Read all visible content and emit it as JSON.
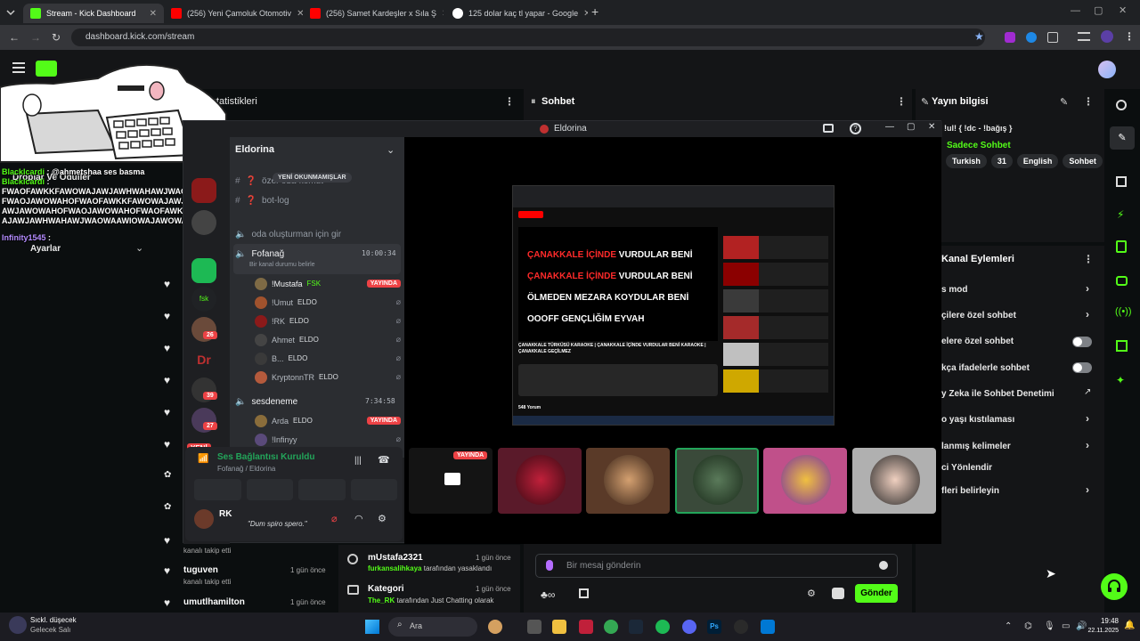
{
  "browser": {
    "tabs": [
      {
        "title": "Stream - Kick Dashboard",
        "color": "#53fc18"
      },
      {
        "title": "(256) Yeni Çamoluk Otomotiv",
        "color": "#ff0000"
      },
      {
        "title": "(256) Samet Kardeşler x Sıla Ş",
        "color": "#ff0000"
      },
      {
        "title": "125 dolar kaç tl yapar - Google",
        "color": "#4285f4"
      }
    ],
    "url": "dashboard.kick.com/stream"
  },
  "kick": {
    "stats_title": "Yayın İstatistikleri",
    "chat_title": "Sohbet",
    "info_title": "Yayın bilgisi",
    "info_line": "!ul! { !dc - !bağış }",
    "sadece": "Sadece Sohbet",
    "tags": [
      "Turkish",
      "31",
      "English",
      "Sohbet"
    ],
    "actions_title": "Kanal Eylemleri",
    "actions": [
      {
        "label": "s mod",
        "ctrl": "chevron"
      },
      {
        "label": "çilere özel sohbet",
        "ctrl": "chevron"
      },
      {
        "label": "elere özel sohbet",
        "ctrl": "toggle"
      },
      {
        "label": "kça ifadelerle sohbet",
        "ctrl": "toggle"
      },
      {
        "label": "y Zeka ile Sohbet Denetimi",
        "ctrl": "external"
      },
      {
        "label": "o yaşı kıstılaması",
        "ctrl": "chevron"
      },
      {
        "label": "lanmış kelimeler",
        "ctrl": "chevron"
      },
      {
        "label": "ci Yönlendir",
        "ctrl": "none"
      },
      {
        "label": "fleri belirleyin",
        "ctrl": "chevron"
      }
    ],
    "drops": "Droplar Ve Ödüller",
    "settings": "Ayarlar",
    "yeni": "YENİ",
    "followers": [
      {
        "name": "tuguven",
        "sub": "kanalı takip etti",
        "time": "1 gün önce"
      },
      {
        "name": "umutlhamilton",
        "sub": "",
        "time": "1 gün önce"
      }
    ],
    "first_follow_sub": "kanalı takip etti",
    "events": [
      {
        "name": "mUstafa2321",
        "by": "furkansalihkaya",
        "rest": "tarafından yasaklandı",
        "time": "1 gün önce"
      },
      {
        "name": "Kategori",
        "by": "The_RK",
        "rest": "tarafından Just Chatting olarak",
        "time": "1 gün önce"
      }
    ],
    "message_placeholder": "Bir mesaj gönderin",
    "send": "Gönder"
  },
  "overlay_chat": [
    {
      "user": "Blacklcardi",
      "text": ": @ahmetshaa ses basma"
    },
    {
      "user": "Blacklcardi",
      "text": ":"
    },
    {
      "user": "",
      "text": "FWAOFAWKKFAWOWAJAWJAWHWAHAWJWAOWAWI"
    },
    {
      "user": "",
      "text": "FWAOJAWOWAHOFWAOFAWKKFAWOWAJAWJAWHWAH"
    },
    {
      "user": "",
      "text": "AWJAWOWAHOFWAOJAWOWAHOFWAOFAWKKFAWOW"
    },
    {
      "user": "",
      "text": "AJAWJAWHWAHAWJWAOWAAWIOWAJAWOWAHO"
    },
    {
      "user": "Infinity1545",
      "text": ":"
    }
  ],
  "discord": {
    "window_title": "Eldorina",
    "server": "Eldorina",
    "new_unread": "YENİ OKUNMAMIŞLAR",
    "channels": [
      {
        "name": "özel-oda-komut"
      },
      {
        "name": "bot-log"
      }
    ],
    "create_room": "oda oluşturman için gir",
    "voice1": {
      "name": "Fofanağ",
      "time": "10:00:34",
      "status": "Bir kanal durumu belirle"
    },
    "users1": [
      {
        "name": "!Mustafa",
        "tag": "FSK",
        "live": true,
        "color": "#7e6a45"
      },
      {
        "name": "!Umut",
        "tag": "ELDO",
        "live": false,
        "color": "#a0522d"
      },
      {
        "name": "!RK",
        "tag": "ELDO",
        "live": false,
        "color": "#8b1a1a"
      },
      {
        "name": "Ahmet",
        "tag": "ELDO",
        "live": false,
        "color": "#444444"
      },
      {
        "name": "B...",
        "tag": "ELDO",
        "live": false,
        "color": "#3a3a3a"
      },
      {
        "name": "KryptonnTR",
        "tag": "ELDO",
        "live": false,
        "color": "#b45a3c"
      }
    ],
    "voice2": {
      "name": "sesdeneme",
      "time": "7:34:58"
    },
    "users2": [
      {
        "name": "Arda",
        "tag": "ELDO",
        "live": true,
        "color": "#8a6d3b"
      },
      {
        "name": "!Infinyy",
        "tag": "",
        "live": false,
        "color": "#5a4a7a"
      }
    ],
    "live_label": "YAYINDA",
    "conn_title": "Ses Bağlantısı Kuruldu",
    "conn_sub": "Fofanağ / Eldorina",
    "me_name": "RK",
    "me_status": "\"Dum spiro spero.\"",
    "server_badges": [
      "26",
      "39",
      "27"
    ]
  },
  "youtube": {
    "lyrics": [
      {
        "a": "ÇANAKKALE İÇİNDE",
        "b": " VURDULAR BENİ"
      },
      {
        "a": "ÇANAKKALE İÇİNDE",
        "b": " VURDULAR BENİ"
      },
      {
        "a": "",
        "b": "ÖLMEDEN MEZARA KOYDULAR BENİ"
      },
      {
        "a": "",
        "b": "OOOFF GENÇLİĞİM EYVAH"
      }
    ],
    "video_title": "ÇANAKKALE TÜRKÜSÜ KARAOKE | ÇANAKKALE İÇİNDE VURDULAR BENİ KARAOKE | ÇANAKKALE GEÇİLMEZ",
    "comments": "548 Yorum"
  },
  "taskbar": {
    "weather_temp": "Sıckl. düşecek",
    "weather_sub": "Gelecek Salı",
    "search": "Ara",
    "time": "19:48",
    "date": "22.11.2025"
  },
  "colors": {
    "kick_green": "#53fc18",
    "discord_live": "#ed4245",
    "send_bg": "#53fc18"
  }
}
